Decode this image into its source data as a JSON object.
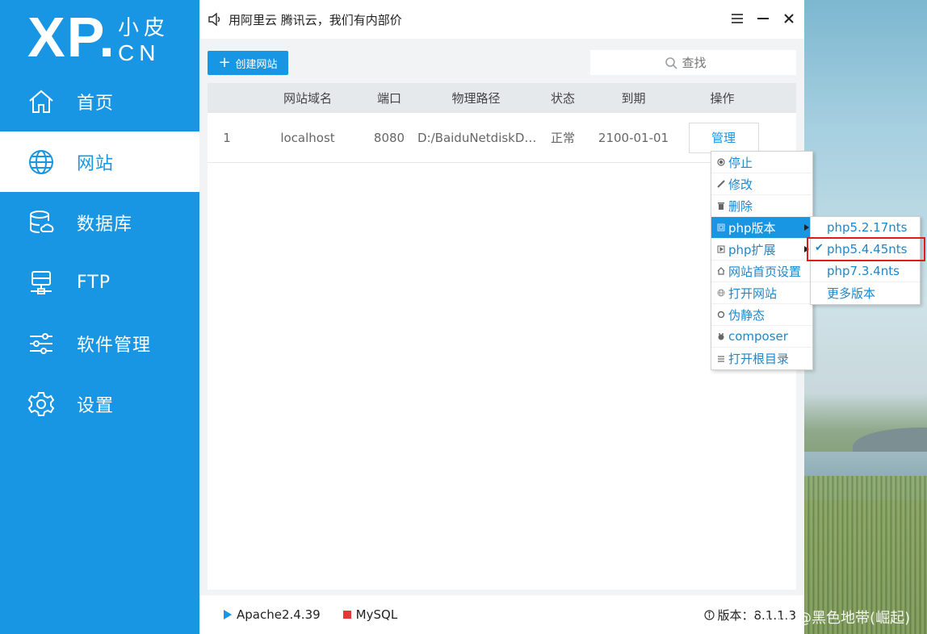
{
  "logo": {
    "main": "XP.",
    "top_cn": "小皮",
    "bottom": "CN"
  },
  "nav": [
    {
      "label": "首页",
      "icon": "home-icon"
    },
    {
      "label": "网站",
      "icon": "globe-icon"
    },
    {
      "label": "数据库",
      "icon": "database-icon"
    },
    {
      "label": "FTP",
      "icon": "ftp-icon"
    },
    {
      "label": "软件管理",
      "icon": "sliders-icon"
    },
    {
      "label": "设置",
      "icon": "gear-icon"
    }
  ],
  "titlebar": {
    "notice": "用阿里云 腾讯云，我们有内部价"
  },
  "toolbar": {
    "create_label": "创建网站",
    "search_placeholder": "查找"
  },
  "table": {
    "headers": [
      "",
      "网站域名",
      "端口",
      "物理路径",
      "状态",
      "到期",
      "操作"
    ],
    "rows": [
      {
        "index": "1",
        "domain": "localhost",
        "port": "8080",
        "path": "D:/BaiduNetdiskDo...",
        "status": "正常",
        "expire": "2100-01-01",
        "action": "管理"
      }
    ]
  },
  "context_menu": {
    "items": [
      {
        "label": "停止",
        "icon": "stop-icon"
      },
      {
        "label": "修改",
        "icon": "pencil-icon"
      },
      {
        "label": "删除",
        "icon": "trash-icon"
      },
      {
        "label": "php版本",
        "icon": "php-icon"
      },
      {
        "label": "php扩展",
        "icon": "extension-icon"
      },
      {
        "label": "网站首页设置",
        "icon": "home-small-icon"
      },
      {
        "label": "打开网站",
        "icon": "globe-small-icon"
      },
      {
        "label": "伪静态",
        "icon": "rewrite-icon"
      },
      {
        "label": "composer",
        "icon": "composer-icon"
      },
      {
        "label": "打开根目录",
        "icon": "list-icon"
      }
    ]
  },
  "php_submenu": {
    "items": [
      "php5.2.17nts",
      "php5.4.45nts",
      "php7.3.4nts",
      "更多版本"
    ],
    "checked": "✔"
  },
  "statusbar": {
    "apache": "Apache2.4.39",
    "mysql": "MySQL",
    "version": "版本：8.1.1.3"
  },
  "watermark": "CSDN @黑色地带(崛起)",
  "colors": {
    "accent": "#1996e3",
    "stopped": "#e53935",
    "highlight_box": "#e01b1b"
  }
}
